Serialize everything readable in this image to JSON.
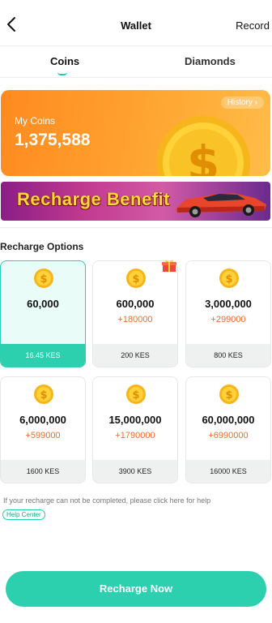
{
  "header": {
    "title": "Wallet",
    "record_label": "Record"
  },
  "tabs": [
    {
      "label": "Coins",
      "active": true
    },
    {
      "label": "Diamonds",
      "active": false
    }
  ],
  "coins_card": {
    "label": "My Coins",
    "amount": "1,375,588",
    "history_label": "History"
  },
  "banner": {
    "text": "Recharge Benefit"
  },
  "options_section": {
    "title": "Recharge Options",
    "items": [
      {
        "amount": "60,000",
        "bonus": "",
        "price": "16.45 KES",
        "selected": true
      },
      {
        "amount": "600,000",
        "bonus": "+180000",
        "price": "200 KES",
        "selected": false
      },
      {
        "amount": "3,000,000",
        "bonus": "+299000",
        "price": "800 KES",
        "selected": false
      },
      {
        "amount": "6,000,000",
        "bonus": "+599000",
        "price": "1600 KES",
        "selected": false
      },
      {
        "amount": "15,000,000",
        "bonus": "+1790000",
        "price": "3900 KES",
        "selected": false
      },
      {
        "amount": "60,000,000",
        "bonus": "+6990000",
        "price": "16000 KES",
        "selected": false
      }
    ]
  },
  "help": {
    "text": "If your recharge can not be completed, please click here for help",
    "link_label": "Help Center"
  },
  "cta": {
    "label": "Recharge Now"
  },
  "colors": {
    "accent": "#2ccfae",
    "bonus": "#f06b2b",
    "coin_card": "#ffa02d"
  },
  "icons": [
    "chevron-left-icon",
    "chevron-right-icon",
    "coin-icon",
    "gift-icon"
  ]
}
